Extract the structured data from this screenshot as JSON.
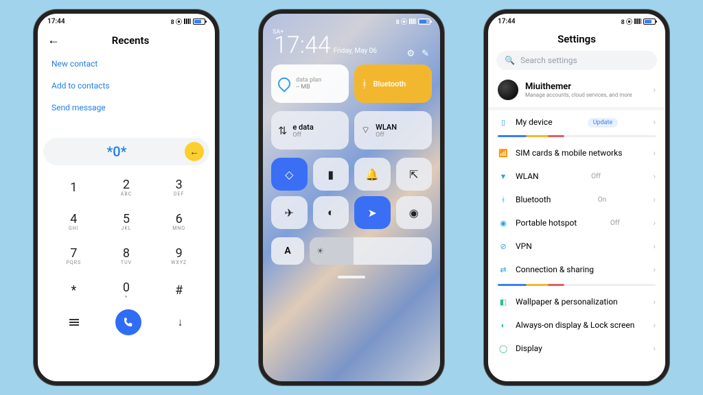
{
  "status": {
    "time": "17:44",
    "indicator": "8 ⦿"
  },
  "phone1": {
    "title": "Recents",
    "links": [
      "New contact",
      "Add to contacts",
      "Send message"
    ],
    "input": "*0*",
    "keys": [
      {
        "n": "1",
        "s": ""
      },
      {
        "n": "2",
        "s": "ABC"
      },
      {
        "n": "3",
        "s": "DEF"
      },
      {
        "n": "4",
        "s": "GHI"
      },
      {
        "n": "5",
        "s": "JKL"
      },
      {
        "n": "6",
        "s": "MNO"
      },
      {
        "n": "7",
        "s": "PQRS"
      },
      {
        "n": "8",
        "s": "TUV"
      },
      {
        "n": "9",
        "s": "WXYZ"
      },
      {
        "n": "*",
        "s": ""
      },
      {
        "n": "0",
        "s": "+"
      },
      {
        "n": "#",
        "s": ""
      }
    ]
  },
  "phone2": {
    "carrier": "SA+",
    "clock": "17:44",
    "date": "Friday, May 06",
    "dataplan": {
      "label": "data plan",
      "sub": "-- MB"
    },
    "bluetooth": {
      "label": "Bluetooth"
    },
    "mobiledata": {
      "label": "e data",
      "sub": "Off"
    },
    "wlan": {
      "label": "WLAN",
      "sub": "Off"
    },
    "auto": "A"
  },
  "phone3": {
    "title": "Settings",
    "search_ph": "Search settings",
    "account": {
      "name": "Miuithemer",
      "sub": "Manage accounts, cloud services, and more"
    },
    "mydevice": {
      "label": "My device",
      "badge": "Update"
    },
    "items": [
      {
        "icon": "📶",
        "color": "#2f9fe8",
        "label": "SIM cards & mobile networks",
        "val": ""
      },
      {
        "icon": "▼",
        "color": "#2f9fe8",
        "label": "WLAN",
        "val": "Off"
      },
      {
        "icon": "ᚼ",
        "color": "#2f9fe8",
        "label": "Bluetooth",
        "val": "On"
      },
      {
        "icon": "◉",
        "color": "#2f9fe8",
        "label": "Portable hotspot",
        "val": "Off"
      },
      {
        "icon": "⊘",
        "color": "#2f9fe8",
        "label": "VPN",
        "val": ""
      },
      {
        "icon": "⇄",
        "color": "#2f9fe8",
        "label": "Connection & sharing",
        "val": ""
      }
    ],
    "items2": [
      {
        "icon": "◧",
        "color": "#29c08a",
        "label": "Wallpaper & personalization"
      },
      {
        "icon": "◐",
        "color": "#29c08a",
        "label": "Always-on display & Lock screen"
      },
      {
        "icon": "◯",
        "color": "#29c08a",
        "label": "Display"
      }
    ]
  }
}
